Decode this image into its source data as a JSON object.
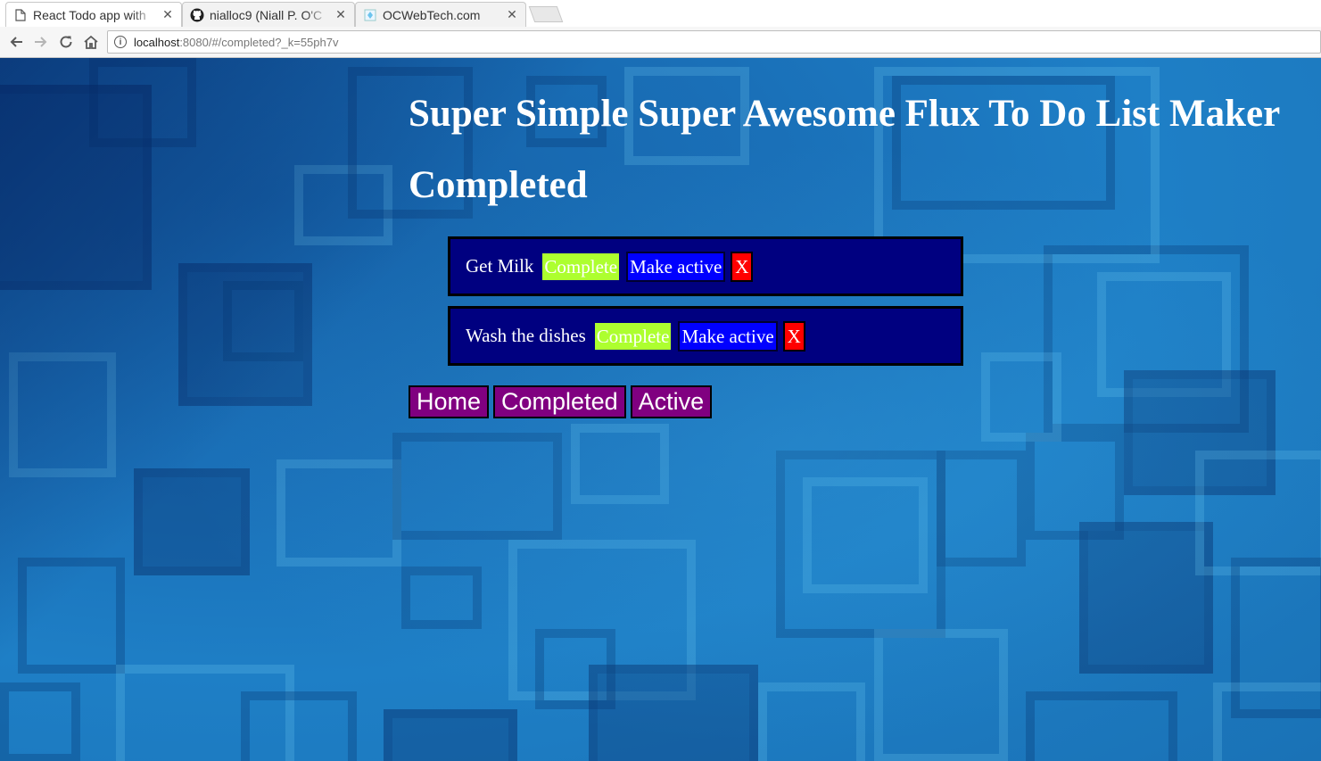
{
  "browser": {
    "tabs": [
      {
        "title": "React Todo app with",
        "icon": "page-icon",
        "active": true
      },
      {
        "title": "nialloc9 (Niall P. O'C",
        "icon": "github-icon",
        "active": false
      },
      {
        "title": "OCWebTech.com",
        "icon": "site-favicon-icon",
        "active": false
      }
    ],
    "url_host": "localhost",
    "url_rest": ":8080/#/completed?_k=55ph7v"
  },
  "page": {
    "title": "Super Simple Super Awesome Flux To Do List Maker",
    "section_heading": "Completed",
    "todos": [
      {
        "text": "Get Milk",
        "complete_label": "Complete",
        "make_active_label": "Make active",
        "delete_label": "X"
      },
      {
        "text": "Wash the dishes",
        "complete_label": "Complete",
        "make_active_label": "Make active",
        "delete_label": "X"
      }
    ],
    "nav": {
      "home_label": "Home",
      "completed_label": "Completed",
      "active_label": "Active"
    }
  },
  "colors": {
    "todo_background": "#000080",
    "complete_button": "#adff2f",
    "make_active_button": "#0000ff",
    "delete_button": "#ff0000",
    "nav_button": "#800080"
  }
}
